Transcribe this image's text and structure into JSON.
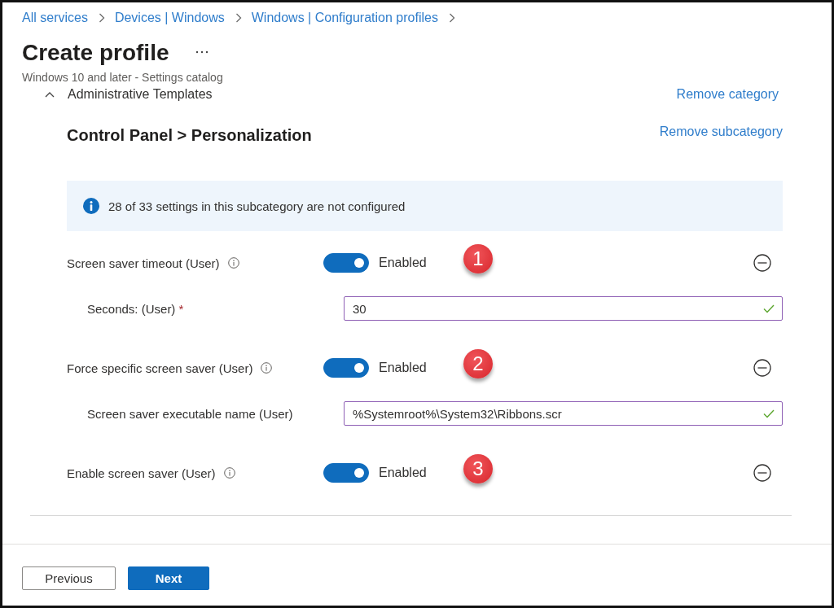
{
  "breadcrumb": [
    {
      "label": "All services"
    },
    {
      "label": "Devices | Windows"
    },
    {
      "label": "Windows | Configuration profiles"
    }
  ],
  "header": {
    "title": "Create profile",
    "subtitle": "Windows 10 and later - Settings catalog"
  },
  "category": {
    "name": "Administrative Templates",
    "expanded": true,
    "remove_link": "Remove category"
  },
  "subcategory": {
    "title": "Control Panel > Personalization",
    "remove_link": "Remove subcategory"
  },
  "info_banner": {
    "text": "28 of 33 settings in this subcategory are not configured"
  },
  "settings": [
    {
      "label": "Screen saver timeout (User)",
      "on": true,
      "state_label": "Enabled",
      "callout": "1",
      "field": {
        "label": "Seconds: (User)",
        "required_mark": "*",
        "value": "30",
        "valid": true
      }
    },
    {
      "label": "Force specific screen saver (User)",
      "on": true,
      "state_label": "Enabled",
      "callout": "2",
      "field": {
        "label": "Screen saver executable name (User)",
        "value": "%Systemroot%\\System32\\Ribbons.scr",
        "valid": true
      }
    },
    {
      "label": "Enable screen saver (User)",
      "on": true,
      "state_label": "Enabled",
      "callout": "3"
    }
  ],
  "footer": {
    "buttons": [
      {
        "label": "Previous",
        "kind": "secondary"
      },
      {
        "label": "Next",
        "kind": "primary"
      }
    ]
  }
}
